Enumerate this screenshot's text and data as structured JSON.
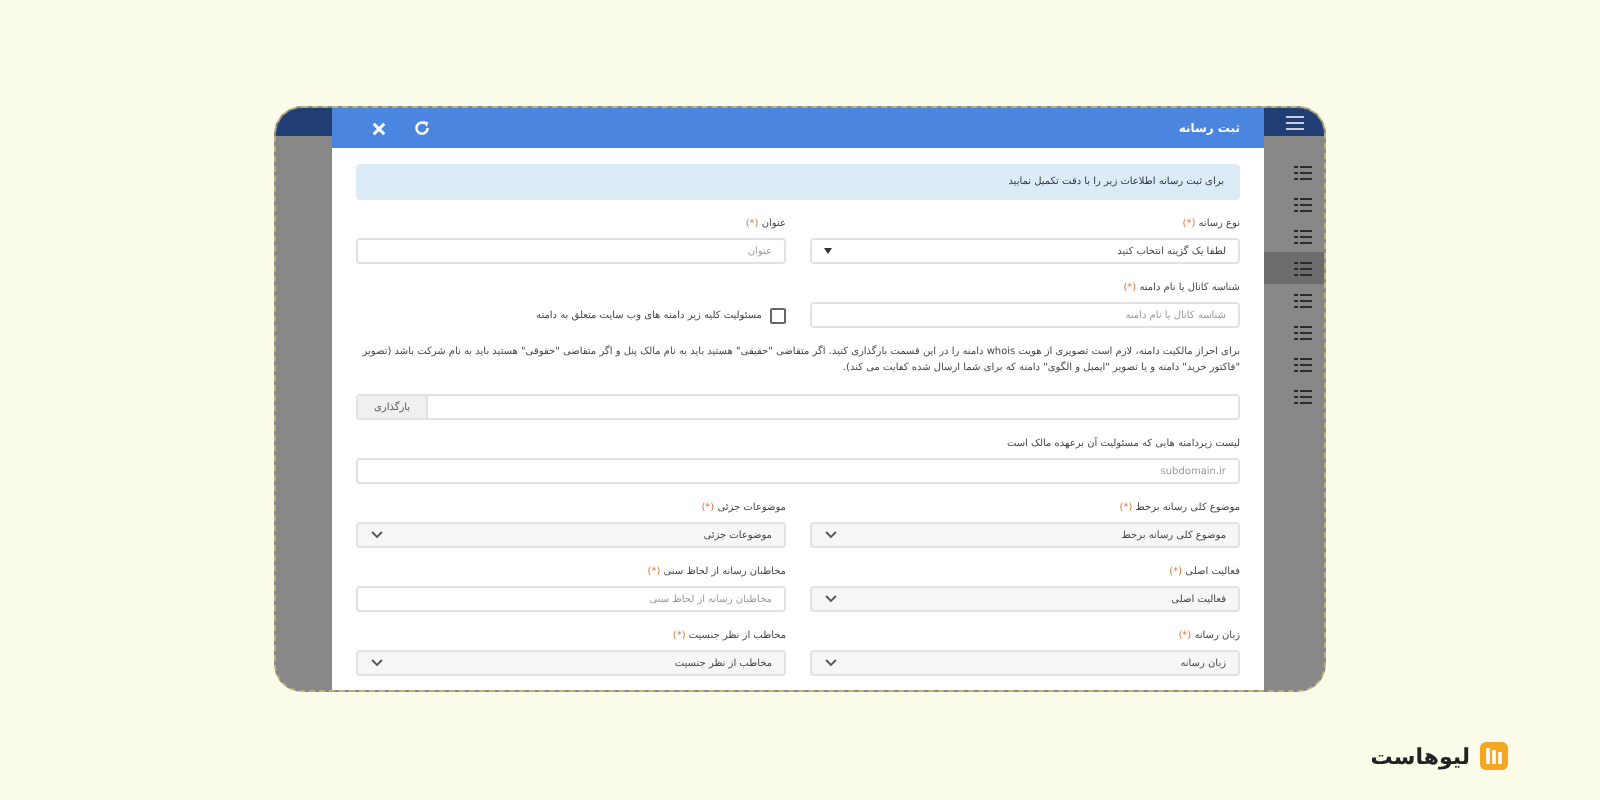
{
  "modal": {
    "title": "ثبت رسانه",
    "header_buttons": [
      {
        "kind": "close"
      },
      {
        "kind": "refresh"
      }
    ],
    "info": "برای ثبت رسانه اطلاعات زیر را با دقت تکمیل نمایید",
    "rows": [
      {
        "fields": [
          {
            "kind": "select",
            "label": "نوع رسانه",
            "mark": "(*)",
            "value": "لطفا یک گزینه انتخاب کنید"
          },
          {
            "kind": "input",
            "label": "عنوان",
            "mark": "(*)",
            "placeholder": "عنوان"
          }
        ]
      },
      {
        "fields": [
          {
            "kind": "input",
            "label": "شناسه کانال یا نام دامنه",
            "mark": "(*)",
            "placeholder": "شناسه کانال یا نام دامنه"
          },
          {
            "kind": "checkbox",
            "label": "مسئولیت کلیه زیر دامنه های وب سایت متعلق به دامنه",
            "checked": false
          }
        ]
      },
      {
        "fields": [
          {
            "kind": "note",
            "text": "برای احراز مالکیت دامنه، لازم است تصویری از هویت whois دامنه را در این قسمت بارگذاری کنید. اگر متقاضی \"حقیقی\" هستید باید به نام مالک پنل و اگر متقاضی \"حقوقی\" هستید باید به نام شرکت باشد (تصویر \"فاکتور خرید\" دامنه و یا تصویر \"ایمیل و الگوی\" دامنه که برای شما ارسال شده کفایت می کند)."
          }
        ]
      },
      {
        "fields": [
          {
            "kind": "file",
            "button": "بارگذاری"
          }
        ]
      },
      {
        "fields": [
          {
            "kind": "input",
            "label": "لیست زیردامنه هایی که مسئولیت آن برعهده مالک است",
            "placeholder": "subdomain.ir"
          }
        ]
      },
      {
        "fields": [
          {
            "kind": "combo",
            "label": "موضوع کلی رسانه برخط",
            "mark": "(*)",
            "value": "موضوع کلی رسانه برخط"
          },
          {
            "kind": "combo",
            "label": "موضوعات جزئی",
            "mark": "(*)",
            "value": "موضوعات جزئی"
          }
        ]
      },
      {
        "fields": [
          {
            "kind": "combo",
            "label": "فعالیت اصلی",
            "mark": "(*)",
            "value": "فعالیت اصلی"
          },
          {
            "kind": "input",
            "label": "مخاطبان رسانه از لحاظ سنی",
            "mark": "(*)",
            "placeholder": "مخاطبان رسانه از لحاظ سنی"
          }
        ]
      },
      {
        "fields": [
          {
            "kind": "combo",
            "label": "زبان رسانه",
            "mark": "(*)",
            "value": "زبان رسانه"
          },
          {
            "kind": "combo",
            "label": "مخاطب از نظر جنسیت",
            "mark": "(*)",
            "value": "مخاطب از نظر جنسیت"
          }
        ]
      }
    ]
  },
  "sidebar": {
    "items": [
      {
        "selected": false
      },
      {
        "selected": false
      },
      {
        "selected": false
      },
      {
        "selected": true
      },
      {
        "selected": false
      },
      {
        "selected": false
      },
      {
        "selected": false
      },
      {
        "selected": false
      }
    ]
  },
  "brand": {
    "name": "لیوهاست"
  }
}
